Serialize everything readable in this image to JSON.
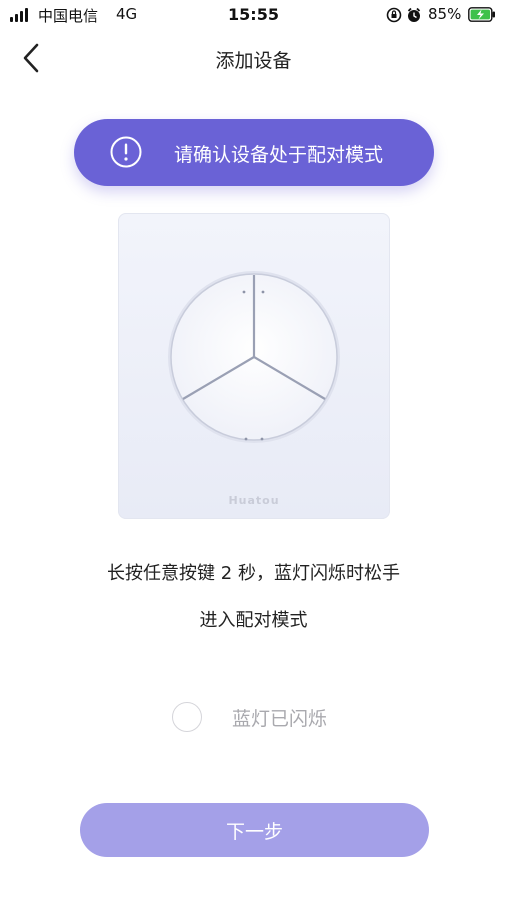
{
  "status_bar": {
    "carrier": "中国电信",
    "network": "4G",
    "time": "15:55",
    "battery": "85%",
    "icons": [
      "signal-icon",
      "orientation-lock-icon",
      "alarm-icon",
      "battery-charging-icon"
    ]
  },
  "nav": {
    "title": "添加设备",
    "back_icon": "chevron-left-icon"
  },
  "banner": {
    "text": "请确认设备处于配对模式",
    "icon": "exclamation-circle-icon"
  },
  "device": {
    "brand": "Huatou"
  },
  "instructions": {
    "line1": "长按任意按键 2 秒，蓝灯闪烁时松手",
    "line2": "进入配对模式"
  },
  "confirm": {
    "label": "蓝灯已闪烁",
    "checked": false
  },
  "next_button": {
    "label": "下一步"
  },
  "colors": {
    "accent": "#6a62d6",
    "button_disabled": "#a4a0e8",
    "muted_text": "#a9a9ae"
  }
}
